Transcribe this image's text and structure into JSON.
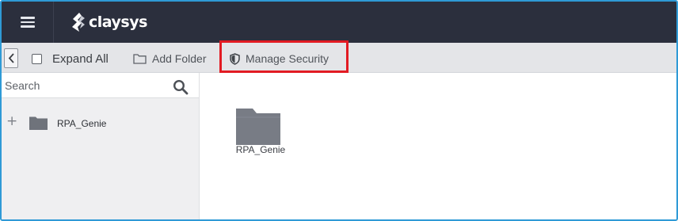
{
  "navbar": {
    "menu_icon": "hamburger-menu-icon",
    "brand": "claysys",
    "colors": {
      "background": "#2b2f3d",
      "text": "#ffffff"
    }
  },
  "toolbar": {
    "collapse_icon": "chevron-left-icon",
    "expand_all_label": "Expand All",
    "add_folder_label": "Add Folder",
    "add_folder_icon": "folder-outline-icon",
    "manage_security_label": "Manage Security",
    "manage_security_icon": "shield-icon",
    "highlight_color": "#e21b23"
  },
  "sidebar": {
    "search": {
      "placeholder": "Search",
      "value": ""
    },
    "tree": [
      {
        "label": "RPA_Genie",
        "expander": "+"
      }
    ]
  },
  "content": {
    "items": [
      {
        "label": "RPA_Genie",
        "icon": "folder-icon"
      }
    ]
  },
  "frame_color": "#2f9ad6"
}
